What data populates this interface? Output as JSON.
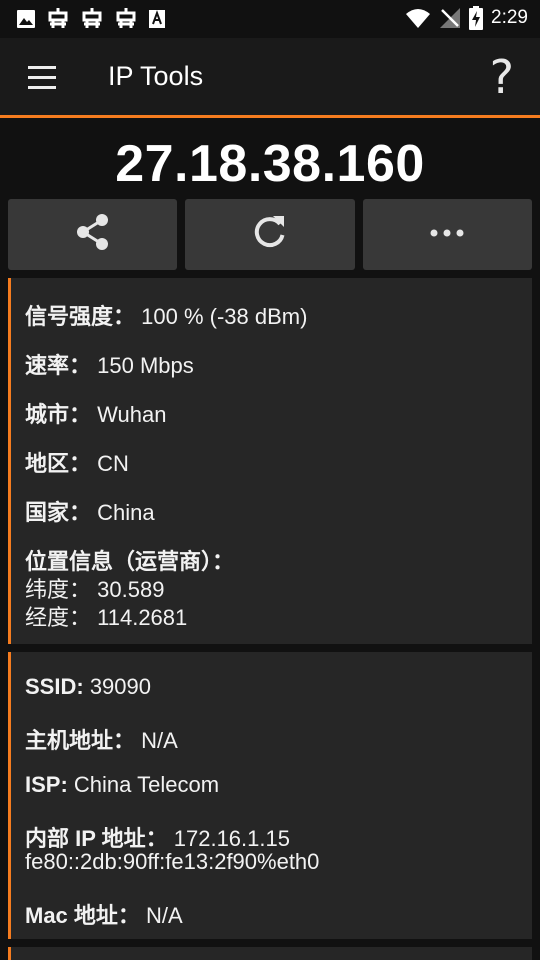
{
  "status_bar": {
    "time": "2:29",
    "left_icons": [
      "image-icon",
      "bug-icon",
      "bug-icon",
      "bug-icon",
      "font-icon"
    ],
    "right_icons": [
      "wifi-icon",
      "no-signal-icon",
      "battery-charging-icon"
    ]
  },
  "app_bar": {
    "title": "IP Tools",
    "menu_icon": "hamburger-menu-icon",
    "help_label": "?"
  },
  "ip_address": "27.18.38.160",
  "actions": [
    {
      "icon": "share-icon"
    },
    {
      "icon": "refresh-icon"
    },
    {
      "icon": "more-icon"
    }
  ],
  "card1": {
    "signal_label": "信号强度：",
    "signal_value": "100 % (-38 dBm)",
    "speed_label": "速率：",
    "speed_value": "150 Mbps",
    "city_label": "城市：",
    "city_value": "Wuhan",
    "region_label": "地区：",
    "region_value": "CN",
    "country_label": "国家：",
    "country_value": "China",
    "location_label": "位置信息（运营商）：",
    "lat_label": "纬度：",
    "lat_value": "30.589",
    "lon_label": "经度：",
    "lon_value": "114.2681"
  },
  "card2": {
    "ssid_label": "SSID:",
    "ssid_value": "39090",
    "host_label": "主机地址：",
    "host_value": "N/A",
    "isp_label": "ISP:",
    "isp_value": "China Telecom",
    "internal_ip_label": "内部 IP 地址：",
    "internal_ip_value": "172.16.1.15",
    "ipv6_value": "fe80::2db:90ff:fe13:2f90%eth0",
    "mac_label": "Mac 地址：",
    "mac_value": "N/A"
  },
  "colors": {
    "accent": "#f57c1f",
    "background": "#111111",
    "card": "#262626",
    "button": "#383838"
  }
}
